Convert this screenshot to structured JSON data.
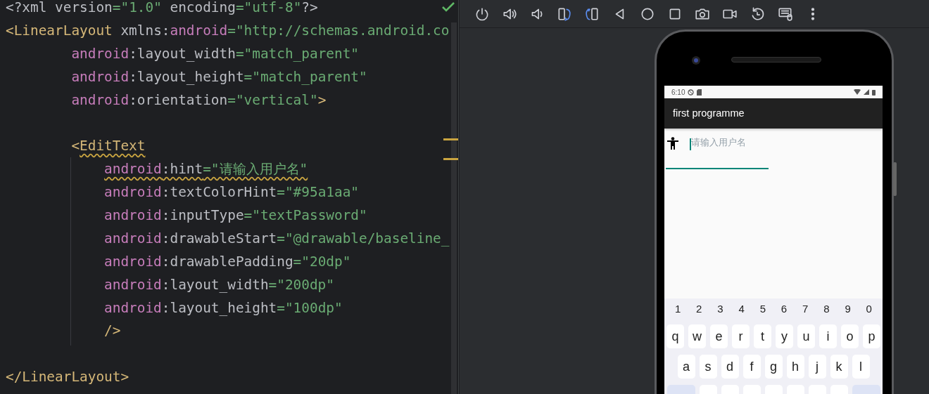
{
  "editor": {
    "inspection_passed": true,
    "lines": [
      {
        "kind": "top",
        "tokens": [
          {
            "kind": "punct",
            "text": "<?"
          },
          {
            "kind": "plain",
            "text": "xml version"
          },
          {
            "kind": "str",
            "text": "=\"1.0\""
          },
          {
            "kind": "plain",
            "text": " encoding"
          },
          {
            "kind": "str",
            "text": "=\"utf-8\""
          },
          {
            "kind": "punct",
            "text": "?>"
          }
        ]
      },
      {
        "kind": "top",
        "tokens": [
          {
            "kind": "tag",
            "text": "<LinearLayout"
          },
          {
            "kind": "plain",
            "text": " xmlns:"
          },
          {
            "kind": "ns",
            "text": "android"
          },
          {
            "kind": "str",
            "text": "=\"http://schemas.android.co"
          }
        ]
      },
      {
        "kind": "attribute",
        "tokens": [
          {
            "kind": "ns",
            "text": "android"
          },
          {
            "kind": "plain",
            "text": ":layout_width"
          },
          {
            "kind": "str",
            "text": "=\"match_parent\""
          }
        ]
      },
      {
        "kind": "attribute",
        "tokens": [
          {
            "kind": "ns",
            "text": "android"
          },
          {
            "kind": "plain",
            "text": ":layout_height"
          },
          {
            "kind": "str",
            "text": "=\"match_parent\""
          }
        ]
      },
      {
        "kind": "attribute",
        "tokens": [
          {
            "kind": "ns",
            "text": "android"
          },
          {
            "kind": "plain",
            "text": ":orientation"
          },
          {
            "kind": "str",
            "text": "=\"vertical\""
          },
          {
            "kind": "tag",
            "text": ">"
          }
        ]
      },
      {
        "kind": "attribute",
        "blank_before": true,
        "tokens": [
          {
            "kind": "tag",
            "text": "<"
          },
          {
            "kind": "tag",
            "text": "EditText",
            "warning": true
          }
        ]
      },
      {
        "kind": "nested",
        "tokens": [
          {
            "kind": "ns",
            "text": "android",
            "warning": true
          },
          {
            "kind": "plain",
            "text": ":hint",
            "warning": true
          },
          {
            "kind": "str",
            "text": "=\"请输入用户名\"",
            "warning": true
          }
        ]
      },
      {
        "kind": "nested",
        "tokens": [
          {
            "kind": "ns",
            "text": "android"
          },
          {
            "kind": "plain",
            "text": ":textColorHint"
          },
          {
            "kind": "str",
            "text": "=\"#95a1aa\""
          }
        ]
      },
      {
        "kind": "nested",
        "tokens": [
          {
            "kind": "ns",
            "text": "android"
          },
          {
            "kind": "plain",
            "text": ":inputType"
          },
          {
            "kind": "str",
            "text": "=\"textPassword\""
          }
        ]
      },
      {
        "kind": "nested",
        "tokens": [
          {
            "kind": "ns",
            "text": "android"
          },
          {
            "kind": "plain",
            "text": ":drawableStart"
          },
          {
            "kind": "str",
            "text": "=\"@drawable/baseline_"
          }
        ]
      },
      {
        "kind": "nested",
        "tokens": [
          {
            "kind": "ns",
            "text": "android"
          },
          {
            "kind": "plain",
            "text": ":drawablePadding"
          },
          {
            "kind": "str",
            "text": "=\"20dp\""
          }
        ]
      },
      {
        "kind": "nested",
        "tokens": [
          {
            "kind": "ns",
            "text": "android"
          },
          {
            "kind": "plain",
            "text": ":layout_width"
          },
          {
            "kind": "str",
            "text": "=\"200dp\""
          }
        ]
      },
      {
        "kind": "nested",
        "tokens": [
          {
            "kind": "ns",
            "text": "android"
          },
          {
            "kind": "plain",
            "text": ":layout_height"
          },
          {
            "kind": "str",
            "text": "=\"100dp\""
          }
        ]
      },
      {
        "kind": "nested",
        "tokens": [
          {
            "kind": "tag",
            "text": "/>"
          }
        ]
      },
      {
        "kind": "top",
        "blank_before": true,
        "tokens": [
          {
            "kind": "tag",
            "text": "</LinearLayout>"
          }
        ]
      }
    ]
  },
  "toolbar": [
    {
      "kind": "power"
    },
    {
      "kind": "volume-up"
    },
    {
      "kind": "volume-down"
    },
    {
      "kind": "rotate-left"
    },
    {
      "kind": "rotate-right"
    },
    {
      "kind": "back"
    },
    {
      "kind": "home"
    },
    {
      "kind": "overview"
    },
    {
      "kind": "screenshot"
    },
    {
      "kind": "record"
    },
    {
      "kind": "reset"
    },
    {
      "kind": "keyboard"
    },
    {
      "kind": "more"
    }
  ],
  "phone": {
    "status_time": "6:10",
    "app_title": "first programme",
    "field": {
      "placeholder": "请输入用户名",
      "focused": true
    },
    "keyboard": {
      "number_row": [
        "1",
        "2",
        "3",
        "4",
        "5",
        "6",
        "7",
        "8",
        "9",
        "0"
      ],
      "rows": [
        [
          "q",
          "w",
          "e",
          "r",
          "t",
          "y",
          "u",
          "i",
          "o",
          "p"
        ],
        [
          "a",
          "s",
          "d",
          "f",
          "g",
          "h",
          "j",
          "k",
          "l"
        ]
      ]
    }
  }
}
